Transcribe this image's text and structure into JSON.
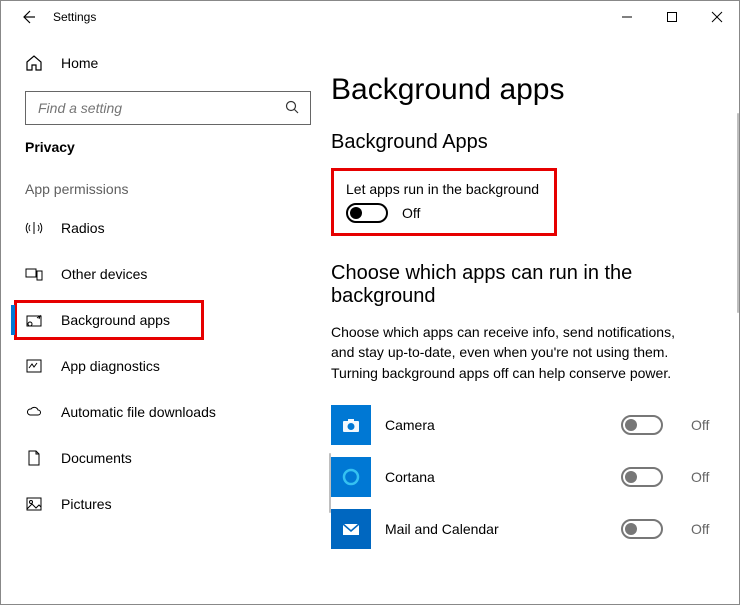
{
  "window": {
    "title": "Settings"
  },
  "sidebar": {
    "home": "Home",
    "search_placeholder": "Find a setting",
    "section": "Privacy",
    "group": "App permissions",
    "items": [
      {
        "label": "Radios"
      },
      {
        "label": "Other devices"
      },
      {
        "label": "Background apps"
      },
      {
        "label": "App diagnostics"
      },
      {
        "label": "Automatic file downloads"
      },
      {
        "label": "Documents"
      },
      {
        "label": "Pictures"
      }
    ]
  },
  "main": {
    "title": "Background apps",
    "section1_heading": "Background Apps",
    "master_toggle_label": "Let apps run in the background",
    "master_toggle_state": "Off",
    "section2_heading": "Choose which apps can run in the background",
    "description": "Choose which apps can receive info, send notifications, and stay up-to-date, even when you're not using them. Turning background apps off can help conserve power.",
    "apps": [
      {
        "name": "Camera",
        "state": "Off",
        "color": "#0078d4"
      },
      {
        "name": "Cortana",
        "state": "Off",
        "color": "#0078d4"
      },
      {
        "name": "Mail and Calendar",
        "state": "Off",
        "color": "#0067c0"
      }
    ]
  }
}
